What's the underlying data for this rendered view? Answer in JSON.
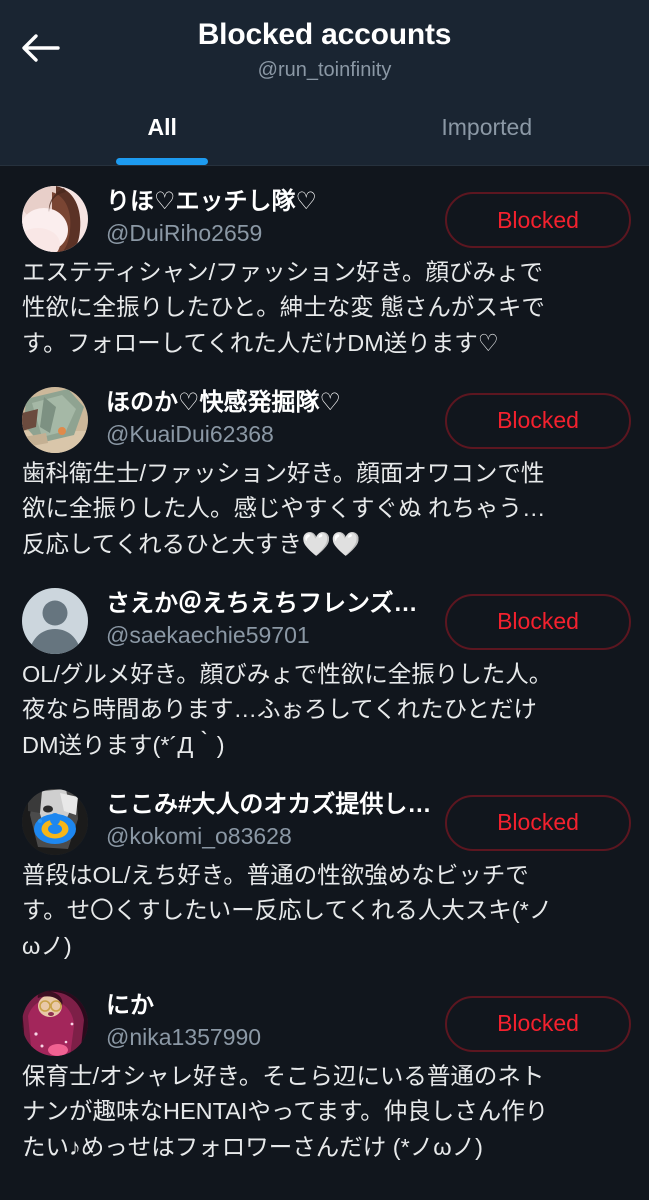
{
  "header": {
    "back_icon": "arrow-left-icon",
    "title": "Blocked accounts",
    "handle": "@run_toinfinity"
  },
  "tabs": [
    {
      "label": "All",
      "active": true
    },
    {
      "label": "Imported",
      "active": false
    }
  ],
  "colors": {
    "header_bg": "#1a2532",
    "list_bg": "#11161d",
    "accent_blue": "#1d9bf0",
    "blocked_red": "#f4212e",
    "blocked_border": "#5c1620",
    "primary_text": "#ffffff",
    "secondary_text": "#8b98a5",
    "bio_text": "#e7e9ea"
  },
  "accounts": [
    {
      "display_name": "りほ♡エッチし隊♡",
      "handle": "@DuiRiho2659",
      "bio": "エステティシャン/ファッション好き。顔びみょで性欲に全振りしたひと。紳士な変 態さんがスキです。フォローしてくれた人だけDM送ります♡",
      "action_label": "Blocked",
      "avatar_type": "photo-pink"
    },
    {
      "display_name": "ほのか♡快感発掘隊♡",
      "handle": "@KuaiDui62368",
      "bio": "歯科衛生士/ファッション好き。顔面オワコンで性欲に全振りした人。感じやすくすぐぬ れちゃう…反応してくれるひと大すき🤍🤍",
      "action_label": "Blocked",
      "avatar_type": "photo-green"
    },
    {
      "display_name": "さえか＠えちえちフレンズが…",
      "handle": "@saekaechie59701",
      "bio": "OL/グルメ好き。顔びみょで性欲に全振りした人。夜なら時間あります…ふぉろしてくれたひとだけDM送ります(*´Д｀)",
      "action_label": "Blocked",
      "avatar_type": "default-person"
    },
    {
      "display_name": "ここみ#大人のオカズ提供し…",
      "handle": "@kokomi_o83628",
      "bio": "普段はOL/えち好き。普通の性欲強めなビッチです。せ〇くすしたいー反応してくれる人大スキ(*ノωノ)",
      "action_label": "Blocked",
      "avatar_type": "photo-pacifier"
    },
    {
      "display_name": "にか",
      "handle": "@nika1357990",
      "bio": "保育士/オシャレ好き。そこら辺にいる普通のネトナンが趣味なHENTAIやってます。仲良しさん作りたい♪めっせはフォロワーさんだけ (*ノωノ)",
      "action_label": "Blocked",
      "avatar_type": "photo-magenta"
    }
  ]
}
